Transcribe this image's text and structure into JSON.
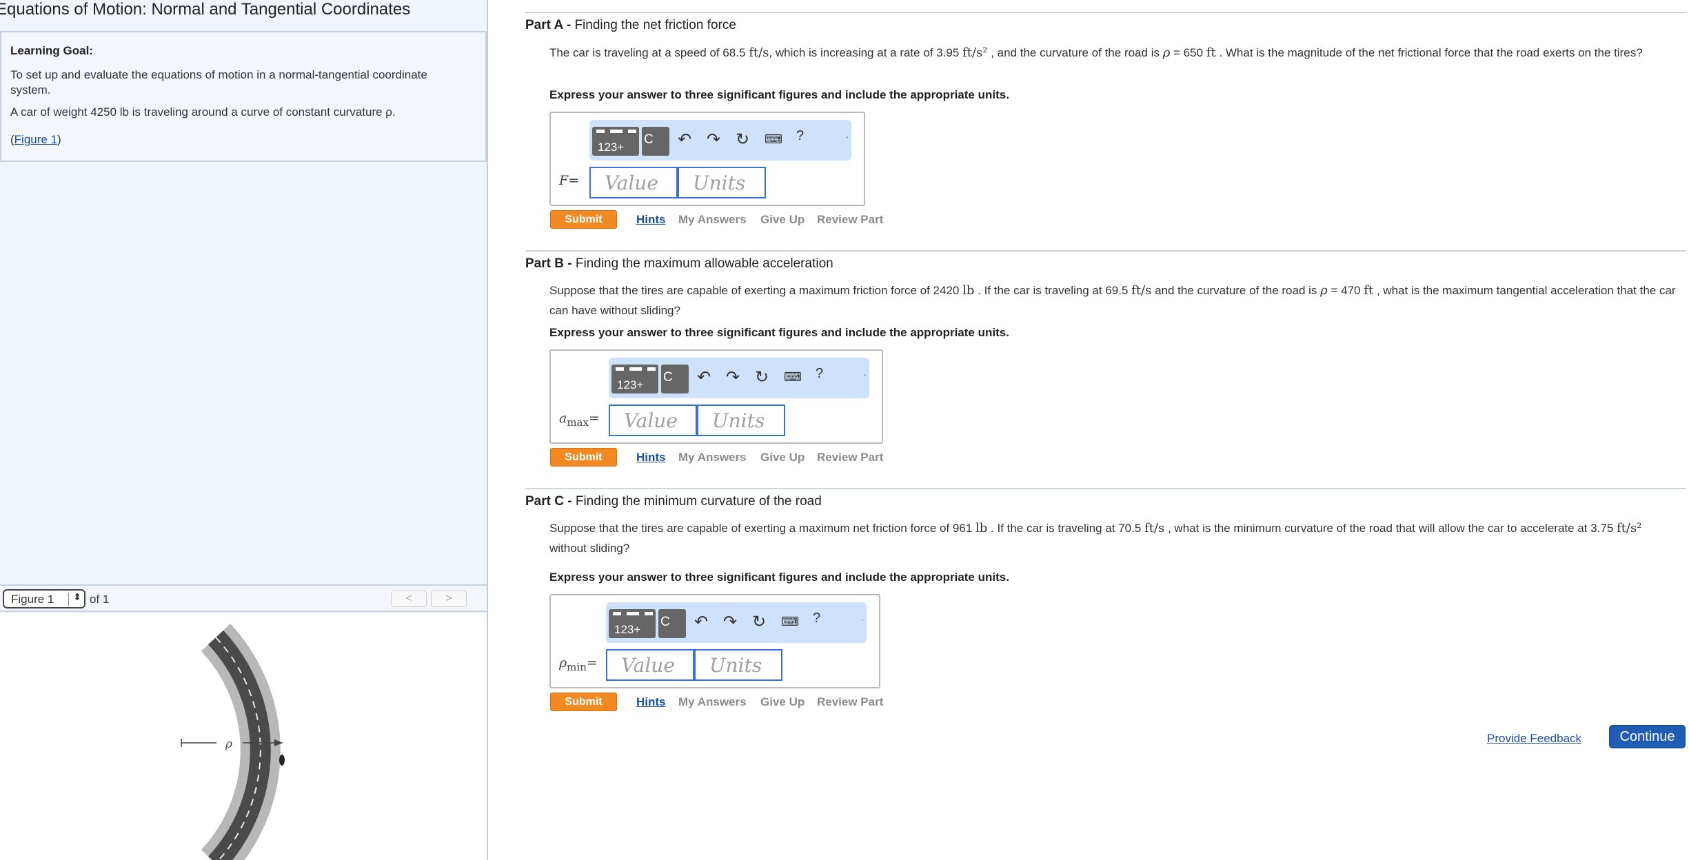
{
  "page_title": "Equations of Motion: Normal and Tangential Coordinates",
  "learning_goal": {
    "heading": "Learning Goal:",
    "text": "To set up and evaluate the equations of motion in a normal-tangential coordinate system.",
    "car_text": "A car of weight 4250 lb is traveling around a curve of constant curvature ρ.",
    "figure_link_open": "(",
    "figure_link": "Figure 1",
    "figure_link_close": ")"
  },
  "figure_viewer": {
    "selected": "Figure 1",
    "of_text": "of 1",
    "prev_label": "<",
    "next_label": ">",
    "rho_label": "ρ"
  },
  "toolbar": {
    "templates_label": "123+",
    "greek_label": "C",
    "help_label": "?",
    "more_label": "·"
  },
  "parts": [
    {
      "letter": "Part A -",
      "title": "Finding the net friction force",
      "question_1": "The car is traveling at a speed of 68.5",
      "q_unit_1": "ft/s",
      "question_2": ", which is increasing at a rate of 3.95",
      "q_unit_2": "ft/s²",
      "question_3": " , and the curvature of the road is",
      "q_rho": "ρ",
      "question_4": "= 650",
      "q_unit_3": "ft",
      "question_5": ". What is the magnitude of the net frictional force that the road exerts on the tires?",
      "instruction": "Express your answer to three significant figures and include the appropriate units.",
      "var_main": "F",
      "var_sub": "",
      "var_eq": "=",
      "value_placeholder": "Value",
      "units_placeholder": "Units",
      "submit": "Submit",
      "hints": "Hints",
      "my_answers": "My Answers",
      "give_up": "Give Up",
      "review": "Review Part"
    },
    {
      "letter": "Part B -",
      "title": "Finding the maximum allowable acceleration",
      "question_1": "Suppose that the tires are capable of exerting a maximum friction force of 2420",
      "q_unit_1": "lb",
      "question_2": ". If the car is traveling at 69.5",
      "q_unit_2": "ft/s",
      "question_3": " and the curvature of the road is",
      "q_rho": "ρ",
      "question_4": "= 470",
      "q_unit_3": "ft",
      "question_5": ", what is the maximum tangential acceleration that the car can have without sliding?",
      "instruction": "Express your answer to three significant figures and include the appropriate units.",
      "var_main": "a",
      "var_sub": "max",
      "var_eq": "=",
      "value_placeholder": "Value",
      "units_placeholder": "Units",
      "submit": "Submit",
      "hints": "Hints",
      "my_answers": "My Answers",
      "give_up": "Give Up",
      "review": "Review Part"
    },
    {
      "letter": "Part C -",
      "title": "Finding the minimum curvature of the road",
      "question_1": "Suppose that the tires are capable of exerting a maximum net friction force of 961",
      "q_unit_1": "lb",
      "question_2": ". If the car is traveling at 70.5",
      "q_unit_2": "ft/s",
      "question_3": ", what is the minimum curvature of the road that will allow the car to accelerate at 3.75",
      "q_rho": "",
      "question_4": "",
      "q_unit_3": "ft/s²",
      "question_5": " without sliding?",
      "instruction": "Express your answer to three significant figures and include the appropriate units.",
      "var_main": "ρ",
      "var_sub": "min",
      "var_eq": "=",
      "value_placeholder": "Value",
      "units_placeholder": "Units",
      "submit": "Submit",
      "hints": "Hints",
      "my_answers": "My Answers",
      "give_up": "Give Up",
      "review": "Review Part"
    }
  ],
  "footer": {
    "feedback": "Provide Feedback",
    "continue": "Continue"
  },
  "colors": {
    "accent_blue": "#1f5db5",
    "submit_orange": "#f28a24",
    "toolbar_blue": "#cfe2fb",
    "pane_bg": "#f0f5fc"
  }
}
